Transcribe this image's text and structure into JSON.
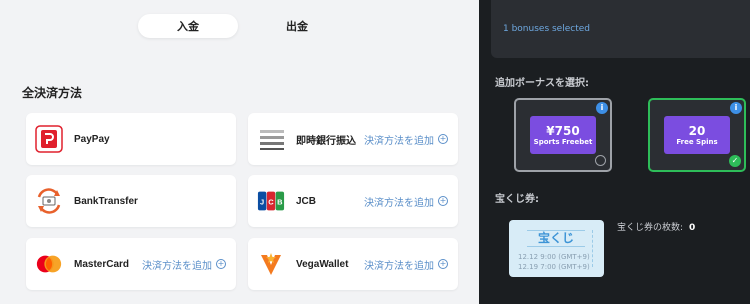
{
  "tabs": {
    "deposit": "入金",
    "withdraw": "出金"
  },
  "section_title": "全決済方法",
  "add_label": "決済方法を追加",
  "methods": [
    {
      "name": "PayPay",
      "icon": "paypay-logo",
      "show_add": false
    },
    {
      "name": "即時銀行振込",
      "icon": "bank-transfer-lines-icon",
      "show_add": true
    },
    {
      "name": "BankTransfer",
      "icon": "bank-transfer-exchange-icon",
      "show_add": false
    },
    {
      "name": "JCB",
      "icon": "jcb-logo",
      "show_add": true
    },
    {
      "name": "MasterCard",
      "icon": "mastercard-logo",
      "show_add": true
    },
    {
      "name": "VegaWallet",
      "icon": "vegawallet-logo",
      "show_add": true
    }
  ],
  "bonus": {
    "selected_text": "1 bonuses selected",
    "choose_label": "追加ボーナスを選択:",
    "cards": [
      {
        "big": "¥750",
        "small": "Sports Freebet",
        "selected": false
      },
      {
        "big": "20",
        "small": "Free Spins",
        "selected": true
      }
    ]
  },
  "lottery": {
    "label": "宝くじ券:",
    "ticket_title": "宝くじ",
    "date1": "12.12 9:00 (GMT+9)",
    "date2": "12.19 7:00 (GMT+9)",
    "count_label": "宝くじ券の枚数:",
    "count_value": "0"
  },
  "colors": {
    "accent_blue": "#5b8fc9",
    "bonus_purple": "#7b4de0",
    "selected_green": "#2ebd59",
    "panel_dark": "#1b1e21"
  }
}
